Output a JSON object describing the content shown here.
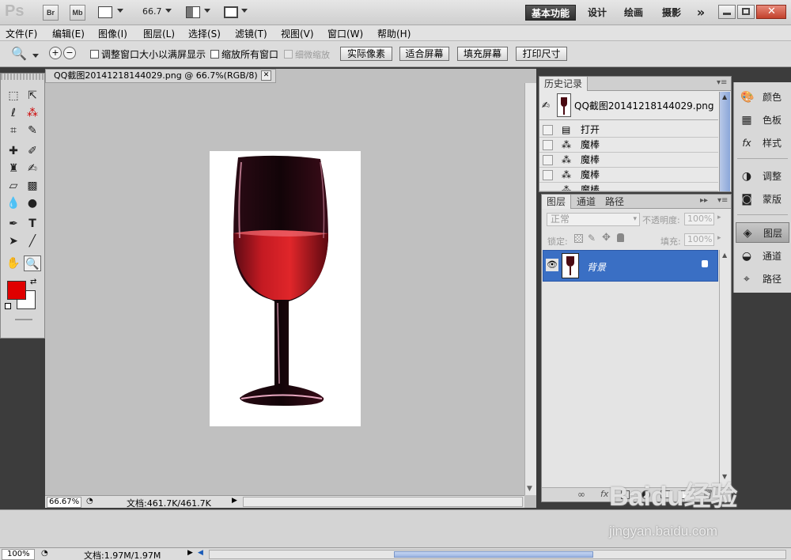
{
  "app": {
    "logo": "Ps",
    "bridge_btn": "Br",
    "minibridge_btn": "Mb",
    "zoom_value": "66.7",
    "workspaces": [
      "基本功能",
      "设计",
      "绘画",
      "摄影"
    ],
    "more_glyph": "»"
  },
  "menu": [
    "文件(F)",
    "编辑(E)",
    "图像(I)",
    "图层(L)",
    "选择(S)",
    "滤镜(T)",
    "视图(V)",
    "窗口(W)",
    "帮助(H)"
  ],
  "options": {
    "resize_windows": "调整窗口大小以满屏显示",
    "zoom_all": "缩放所有窗口",
    "scrubby_zoom": "细微缩放",
    "actual_pixels": "实际像素",
    "fit_screen": "适合屏幕",
    "fill_screen": "填充屏幕",
    "print_size": "打印尺寸"
  },
  "document": {
    "tab_title": "QQ截图20141218144029.png @ 66.7%(RGB/8)",
    "zoom": "66.67%",
    "doc_size": "文档:461.7K/461.7K"
  },
  "history": {
    "tab": "历史记录",
    "snapshot": "QQ截图20141218144029.png",
    "items": [
      "打开",
      "魔棒",
      "魔棒",
      "魔棒",
      "魔棒"
    ]
  },
  "layers": {
    "tabs": [
      "图层",
      "通道",
      "路径"
    ],
    "blend_mode": "正常",
    "opacity_label": "不透明度:",
    "opacity_value": "100%",
    "lock_label": "锁定:",
    "fill_label": "填充:",
    "fill_value": "100%",
    "layer_name": "背景"
  },
  "dock": [
    "颜色",
    "色板",
    "样式",
    "调整",
    "蒙版",
    "图层",
    "通道",
    "路径"
  ],
  "status": {
    "zoom": "100%",
    "doc_size": "文档:1.97M/1.97M"
  },
  "watermark": {
    "brand": "Baidu经验",
    "url": "jingyan.baidu.com"
  },
  "colors": {
    "foreground": "#e00000",
    "background": "#ffffff",
    "selection_blue": "#3a6fc4"
  }
}
